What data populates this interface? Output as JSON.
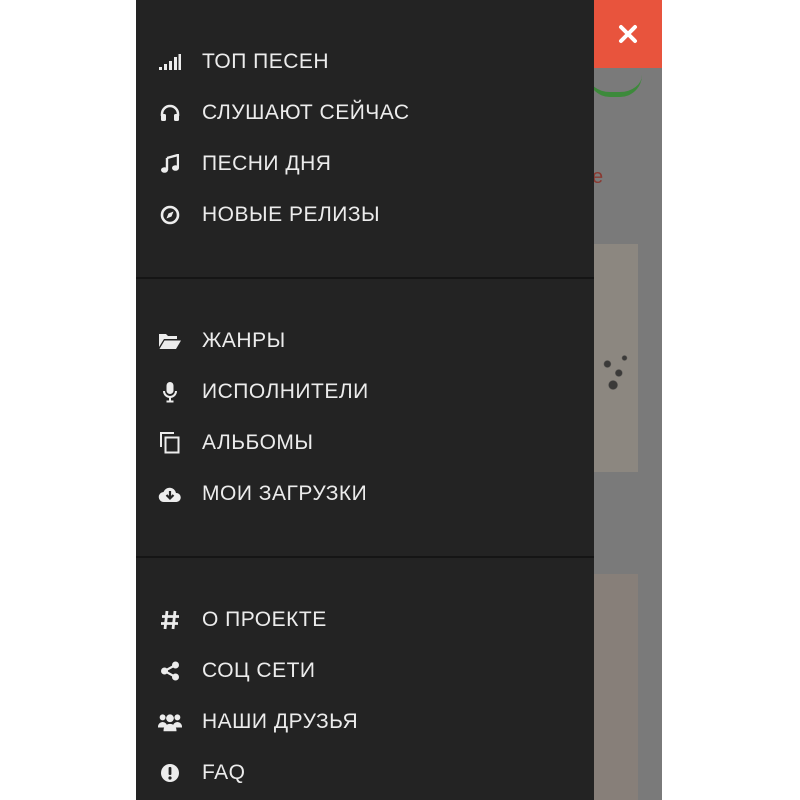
{
  "drawer": {
    "groups": [
      {
        "items": [
          {
            "label": "ТОП ПЕСЕН",
            "icon": "signal-bars-icon"
          },
          {
            "label": "СЛУШАЮТ СЕЙЧАС",
            "icon": "headphones-icon"
          },
          {
            "label": "ПЕСНИ ДНЯ",
            "icon": "music-note-icon"
          },
          {
            "label": "НОВЫЕ РЕЛИЗЫ",
            "icon": "compass-icon"
          }
        ]
      },
      {
        "items": [
          {
            "label": "ЖАНРЫ",
            "icon": "folder-open-icon"
          },
          {
            "label": "ИСПОЛНИТЕЛИ",
            "icon": "microphone-icon"
          },
          {
            "label": "АЛЬБОМЫ",
            "icon": "copy-icon"
          },
          {
            "label": "МОИ ЗАГРУЗКИ",
            "icon": "cloud-download-icon"
          }
        ]
      },
      {
        "items": [
          {
            "label": "О ПРОЕКТЕ",
            "icon": "hashtag-icon"
          },
          {
            "label": "СОЦ СЕТИ",
            "icon": "share-icon"
          },
          {
            "label": "НАШИ ДРУЗЬЯ",
            "icon": "users-icon"
          },
          {
            "label": "FAQ",
            "icon": "exclamation-circle-icon"
          }
        ]
      }
    ]
  },
  "close_button": {
    "icon": "close-icon"
  },
  "colors": {
    "drawer_bg": "#232323",
    "menu_text": "#ececec",
    "close_bg": "#e8543d",
    "overlay": "#7a7a7a"
  }
}
